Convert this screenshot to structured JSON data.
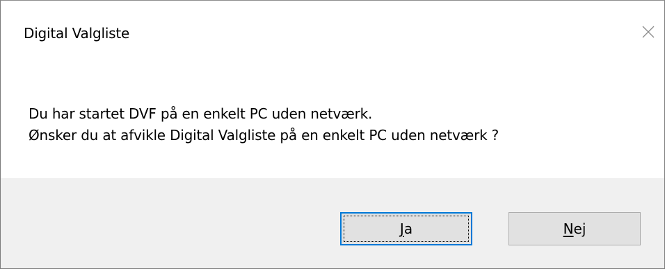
{
  "dialog": {
    "title": "Digital Valgliste",
    "message_lines": [
      "Du har startet DVF på en enkelt PC uden netværk.",
      "Ønsker du at afvikle Digital Valgliste på en enkelt PC uden netværk ?"
    ],
    "close_icon": "close-icon",
    "buttons": {
      "yes": {
        "mnemonic": "J",
        "rest": "a"
      },
      "no": {
        "mnemonic": "N",
        "rest": "ej"
      }
    }
  },
  "colors": {
    "footer_bg": "#f0f0f0",
    "button_bg": "#e1e1e1",
    "focus_border": "#0078d7"
  }
}
